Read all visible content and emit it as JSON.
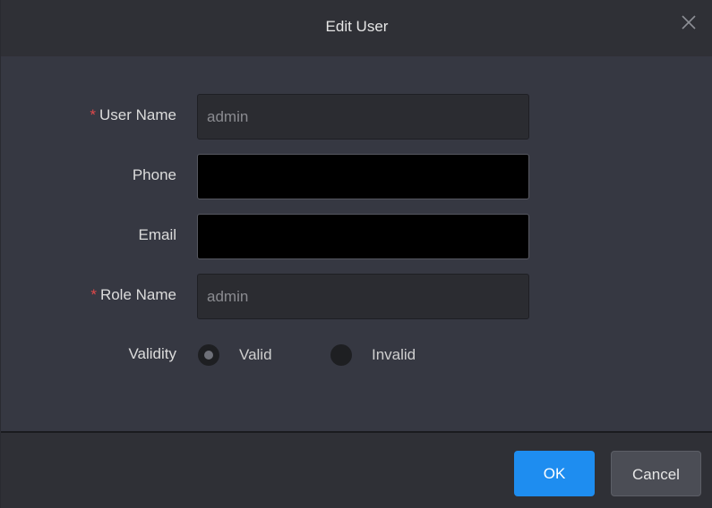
{
  "dialog": {
    "title": "Edit User",
    "close_icon": "close-icon"
  },
  "form": {
    "required_mark": "*",
    "user_name": {
      "label": "User Name",
      "value": "admin",
      "required": true
    },
    "phone": {
      "label": "Phone",
      "value": "",
      "required": false
    },
    "email": {
      "label": "Email",
      "value": "",
      "required": false
    },
    "role_name": {
      "label": "Role Name",
      "value": "admin",
      "required": true
    },
    "validity": {
      "label": "Validity",
      "options": [
        "Valid",
        "Invalid"
      ],
      "selected": "Valid"
    }
  },
  "footer": {
    "ok_label": "OK",
    "cancel_label": "Cancel"
  },
  "colors": {
    "accent": "#1e8df0",
    "required": "#e0484a",
    "background": "#363842"
  }
}
